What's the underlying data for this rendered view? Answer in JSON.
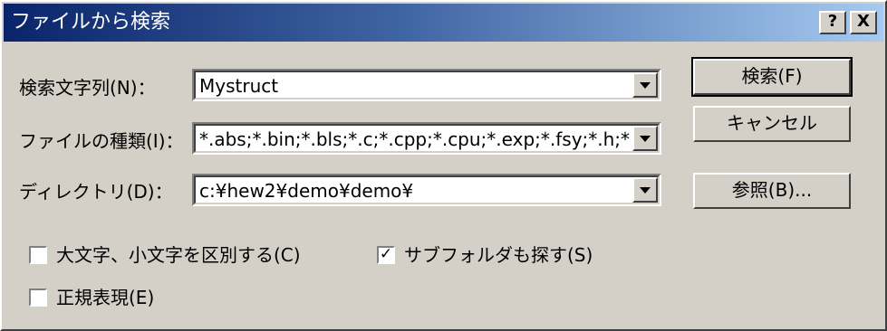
{
  "window": {
    "title": "ファイルから検索",
    "help_button": "?",
    "close_button": "X"
  },
  "fields": {
    "search_string": {
      "label": "検索文字列(N)：",
      "value": "Mystruct"
    },
    "file_types": {
      "label": "ファイルの種類(I)：",
      "value": "*.abs;*.bin;*.bls;*.c;*.cpp;*.cpu;*.exp;*.fsy;*.h;*.he"
    },
    "directory": {
      "label": "ディレクトリ(D)：",
      "value": "c:¥hew2¥demo¥demo¥"
    }
  },
  "buttons": {
    "search": "検索(F)",
    "cancel": "キャンセル",
    "browse": "参照(B)..."
  },
  "options": {
    "match_case": {
      "label": "大文字、小文字を区別する(C)",
      "checked": false
    },
    "search_subfolders": {
      "label": "サブフォルダも探す(S)",
      "checked": true
    },
    "regex": {
      "label": "正規表現(E)",
      "checked": false
    }
  }
}
